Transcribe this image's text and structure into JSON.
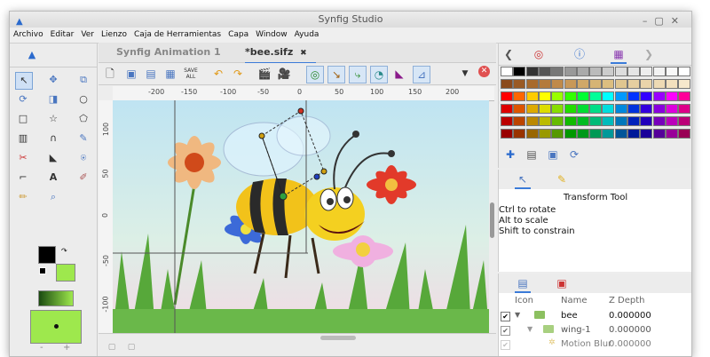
{
  "window": {
    "title": "Synfig Studio"
  },
  "menu": [
    "Archivo",
    "Editar",
    "Ver",
    "Lienzo",
    "Caja de Herramientas",
    "Capa",
    "Window",
    "Ayuda"
  ],
  "tabs": [
    {
      "label": "Synfig Animation 1",
      "close": "✖"
    },
    {
      "label": "*bee.sifz",
      "close": "✖"
    }
  ],
  "toolbar": {
    "save_all_label": "SAVE ALL"
  },
  "ruler": {
    "ticks": [
      "-200",
      "-150",
      "-100",
      "-50",
      "0",
      "50",
      "100",
      "150",
      "200"
    ],
    "vticks": [
      "100",
      "50",
      "0",
      "-50",
      "-100"
    ]
  },
  "tool_options": {
    "title": "Transform Tool",
    "lines": [
      "Ctrl to rotate",
      "Alt to scale",
      "Shift to constrain"
    ]
  },
  "layers": {
    "columns": [
      "Icon",
      "Name",
      "Z Depth"
    ],
    "rows": [
      {
        "name": "bee",
        "z": "0.000000"
      },
      {
        "name": "wing-1",
        "z": "0.000000"
      },
      {
        "name": "Motion Blur",
        "z": "0.000000"
      }
    ]
  },
  "palette_colors": [
    [
      "#ffffff",
      "#000000",
      "#333333",
      "#555555",
      "#777777",
      "#999999",
      "#aaaaaa",
      "#bbbbbb",
      "#cccccc",
      "#dddddd",
      "#e5e5e5",
      "#eeeeee",
      "#f3f3f3",
      "#f8f8f8",
      "#ffffff"
    ],
    [
      "#8b4a1c",
      "#9a5a24",
      "#a86a2c",
      "#b47a3a",
      "#c08a4a",
      "#c89858",
      "#d0a868",
      "#d6b474",
      "#dcbe80",
      "#e0c690",
      "#e6cea0",
      "#ead4aa",
      "#eedab4",
      "#f2e0be",
      "#f6e8cc"
    ],
    [
      "#ff0000",
      "#ff6600",
      "#ffcc00",
      "#ffff00",
      "#99ff00",
      "#33ff00",
      "#00ff33",
      "#00ff99",
      "#00ffff",
      "#0099ff",
      "#0033ff",
      "#3300ff",
      "#9900ff",
      "#ff00ff",
      "#ff0099"
    ],
    [
      "#dd0000",
      "#dd5500",
      "#ddaa00",
      "#dddd00",
      "#88dd00",
      "#22dd00",
      "#00dd33",
      "#00dd88",
      "#00dddd",
      "#0088dd",
      "#0033dd",
      "#3300dd",
      "#8800dd",
      "#dd00dd",
      "#dd0088"
    ],
    [
      "#bb0000",
      "#bb4400",
      "#bb8800",
      "#bbbb00",
      "#66bb00",
      "#11bb00",
      "#00bb22",
      "#00bb77",
      "#00bbbb",
      "#0077bb",
      "#0022bb",
      "#2200bb",
      "#7700bb",
      "#bb00bb",
      "#bb0077"
    ],
    [
      "#990000",
      "#993300",
      "#996600",
      "#999900",
      "#559900",
      "#009900",
      "#00991a",
      "#009955",
      "#009999",
      "#005599",
      "#001a99",
      "#1a0099",
      "#550099",
      "#990099",
      "#990055"
    ]
  ],
  "colors": {
    "outline": "#000000",
    "fill": "#9ee84d",
    "accent": "#3b7bd8"
  }
}
